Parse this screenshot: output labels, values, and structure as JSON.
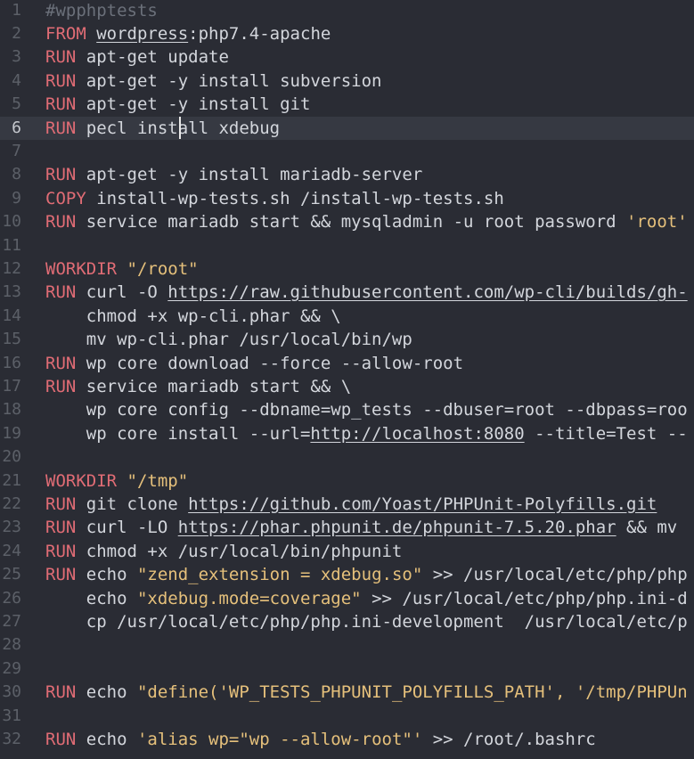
{
  "editor": {
    "active_line": 6,
    "lines": [
      {
        "num": "1",
        "tokens": [
          {
            "t": "#wpphptests",
            "c": "com"
          }
        ]
      },
      {
        "num": "2",
        "tokens": [
          {
            "t": "FROM",
            "c": "kw"
          },
          {
            "t": " ",
            "c": "plain"
          },
          {
            "t": "wordpress",
            "c": "url"
          },
          {
            "t": ":php7.4-apache",
            "c": "plain"
          }
        ]
      },
      {
        "num": "3",
        "tokens": [
          {
            "t": "RUN",
            "c": "kw"
          },
          {
            "t": " apt-get update",
            "c": "plain"
          }
        ]
      },
      {
        "num": "4",
        "tokens": [
          {
            "t": "RUN",
            "c": "kw"
          },
          {
            "t": " apt-get -y install subversion",
            "c": "plain"
          }
        ]
      },
      {
        "num": "5",
        "tokens": [
          {
            "t": "RUN",
            "c": "kw"
          },
          {
            "t": " apt-get -y install git",
            "c": "plain"
          }
        ]
      },
      {
        "num": "6",
        "tokens": [
          {
            "t": "RUN",
            "c": "kw"
          },
          {
            "t": " pecl install xdebug",
            "c": "plain"
          }
        ]
      },
      {
        "num": "7",
        "tokens": []
      },
      {
        "num": "8",
        "tokens": [
          {
            "t": "RUN",
            "c": "kw"
          },
          {
            "t": " apt-get -y install mariadb-server",
            "c": "plain"
          }
        ]
      },
      {
        "num": "9",
        "tokens": [
          {
            "t": "COPY",
            "c": "kw"
          },
          {
            "t": " install-wp-tests.sh /install-wp-tests.sh",
            "c": "plain"
          }
        ]
      },
      {
        "num": "10",
        "tokens": [
          {
            "t": "RUN",
            "c": "kw"
          },
          {
            "t": " service mariadb start && mysqladmin -u root password ",
            "c": "plain"
          },
          {
            "t": "'root'",
            "c": "str"
          }
        ]
      },
      {
        "num": "11",
        "tokens": []
      },
      {
        "num": "12",
        "tokens": [
          {
            "t": "WORKDIR",
            "c": "kw"
          },
          {
            "t": " ",
            "c": "plain"
          },
          {
            "t": "\"/root\"",
            "c": "str"
          }
        ]
      },
      {
        "num": "13",
        "tokens": [
          {
            "t": "RUN",
            "c": "kw"
          },
          {
            "t": " curl -O ",
            "c": "plain"
          },
          {
            "t": "https://raw.githubusercontent.com/wp-cli/builds/gh-",
            "c": "url"
          }
        ]
      },
      {
        "num": "14",
        "tokens": [
          {
            "t": "    chmod +x wp-cli.phar && \\",
            "c": "plain"
          }
        ]
      },
      {
        "num": "15",
        "tokens": [
          {
            "t": "    mv wp-cli.phar /usr/local/bin/wp",
            "c": "plain"
          }
        ]
      },
      {
        "num": "16",
        "tokens": [
          {
            "t": "RUN",
            "c": "kw"
          },
          {
            "t": " wp core download --force --allow-root",
            "c": "plain"
          }
        ]
      },
      {
        "num": "17",
        "tokens": [
          {
            "t": "RUN",
            "c": "kw"
          },
          {
            "t": " service mariadb start && \\",
            "c": "plain"
          }
        ]
      },
      {
        "num": "18",
        "tokens": [
          {
            "t": "    wp core config --dbname=wp_tests --dbuser=root --dbpass=roo",
            "c": "plain"
          }
        ]
      },
      {
        "num": "19",
        "tokens": [
          {
            "t": "    wp core install --url=",
            "c": "plain"
          },
          {
            "t": "http://localhost:8080",
            "c": "url"
          },
          {
            "t": " --title=Test --",
            "c": "plain"
          }
        ]
      },
      {
        "num": "20",
        "tokens": []
      },
      {
        "num": "21",
        "tokens": [
          {
            "t": "WORKDIR",
            "c": "kw"
          },
          {
            "t": " ",
            "c": "plain"
          },
          {
            "t": "\"/tmp\"",
            "c": "str"
          }
        ]
      },
      {
        "num": "22",
        "tokens": [
          {
            "t": "RUN",
            "c": "kw"
          },
          {
            "t": " git clone ",
            "c": "plain"
          },
          {
            "t": "https://github.com/Yoast/PHPUnit-Polyfills.git",
            "c": "url"
          }
        ]
      },
      {
        "num": "23",
        "tokens": [
          {
            "t": "RUN",
            "c": "kw"
          },
          {
            "t": " curl -LO ",
            "c": "plain"
          },
          {
            "t": "https://phar.phpunit.de/phpunit-7.5.20.phar",
            "c": "url"
          },
          {
            "t": " && mv ",
            "c": "plain"
          }
        ]
      },
      {
        "num": "24",
        "tokens": [
          {
            "t": "RUN",
            "c": "kw"
          },
          {
            "t": " chmod +x /usr/local/bin/phpunit",
            "c": "plain"
          }
        ]
      },
      {
        "num": "25",
        "tokens": [
          {
            "t": "RUN",
            "c": "kw"
          },
          {
            "t": " echo ",
            "c": "plain"
          },
          {
            "t": "\"zend_extension = xdebug.so\"",
            "c": "str"
          },
          {
            "t": " >> /usr/local/etc/php/php",
            "c": "plain"
          }
        ]
      },
      {
        "num": "26",
        "tokens": [
          {
            "t": "    echo ",
            "c": "plain"
          },
          {
            "t": "\"xdebug.mode=coverage\"",
            "c": "str"
          },
          {
            "t": " >> /usr/local/etc/php/php.ini-d",
            "c": "plain"
          }
        ]
      },
      {
        "num": "27",
        "tokens": [
          {
            "t": "    cp /usr/local/etc/php/php.ini-development  /usr/local/etc/p",
            "c": "plain"
          }
        ]
      },
      {
        "num": "28",
        "tokens": []
      },
      {
        "num": "29",
        "tokens": []
      },
      {
        "num": "30",
        "tokens": [
          {
            "t": "RUN",
            "c": "kw"
          },
          {
            "t": " echo ",
            "c": "plain"
          },
          {
            "t": "\"define('WP_TESTS_PHPUNIT_POLYFILLS_PATH', '/tmp/PHPUn",
            "c": "str"
          }
        ]
      },
      {
        "num": "31",
        "tokens": []
      },
      {
        "num": "32",
        "tokens": [
          {
            "t": "RUN",
            "c": "kw"
          },
          {
            "t": " echo ",
            "c": "plain"
          },
          {
            "t": "'alias wp=\"wp --allow-root\"'",
            "c": "str"
          },
          {
            "t": " >> /root/.bashrc",
            "c": "plain"
          }
        ]
      }
    ]
  }
}
